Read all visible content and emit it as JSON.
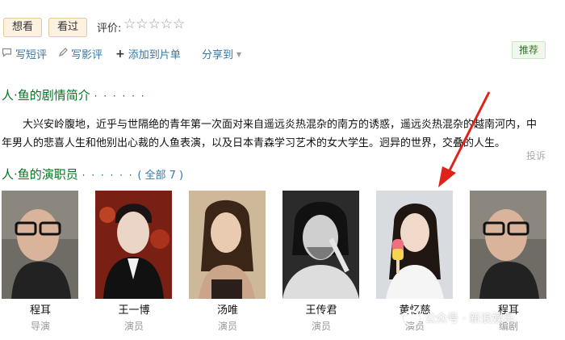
{
  "buttons": {
    "want": "想看",
    "seen": "看过"
  },
  "rating": {
    "label": "评价:",
    "stars": "☆☆☆☆☆"
  },
  "actions": {
    "short_review": "写短评",
    "review": "写影评",
    "add_list": "添加到片单",
    "share": "分享到",
    "share_caret": "▾"
  },
  "recommend_label": "推荐",
  "synopsis": {
    "title": "人·鱼的剧情简介",
    "dots": "· · · · · ·",
    "text": "大兴安岭腹地，近乎与世隔绝的青年第一次面对来自遥远炎热混杂的南方的诱惑，遥远炎热混杂的越南河内，中年男人的悲喜人生和他别出心裁的人鱼表演，以及日本青森学习艺术的女大学生。迥异的世界，交叠的人生。",
    "report": "投诉"
  },
  "cast": {
    "title": "人·鱼的演职员",
    "dots": "· · · · · ·",
    "more": "( 全部 7 )",
    "members": [
      {
        "name": "程耳",
        "role": "导演"
      },
      {
        "name": "王一博",
        "role": "演员"
      },
      {
        "name": "汤唯",
        "role": "演员"
      },
      {
        "name": "王传君",
        "role": "演员"
      },
      {
        "name": "黄忆慈",
        "role": "演员"
      },
      {
        "name": "程耳",
        "role": "编剧"
      }
    ]
  },
  "watermark": "公众号 · 新浪娱乐",
  "colors": {
    "green": "#007722",
    "link": "#3377aa",
    "arrow": "#e0221b"
  }
}
